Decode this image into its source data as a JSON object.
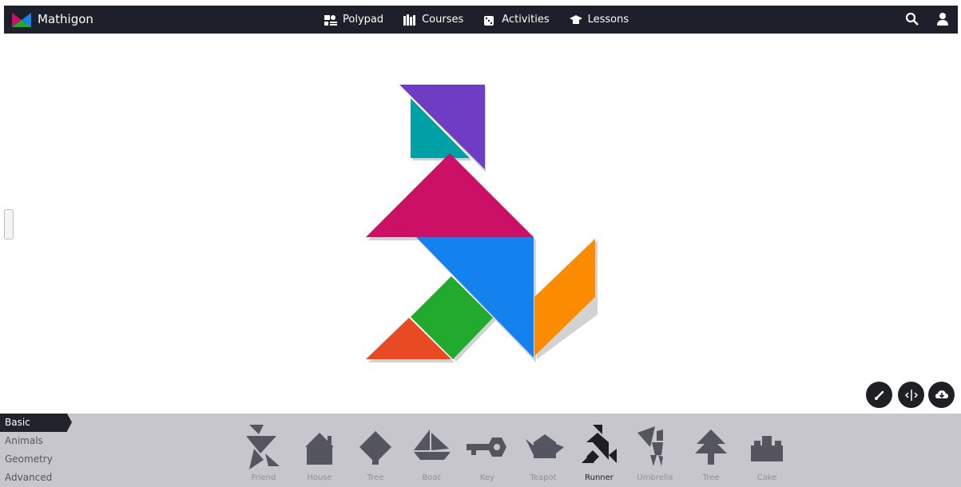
{
  "brand": {
    "name": "Mathigon"
  },
  "nav": [
    {
      "label": "Polypad",
      "icon": "polypad-icon"
    },
    {
      "label": "Courses",
      "icon": "courses-icon"
    },
    {
      "label": "Activities",
      "icon": "activities-icon"
    },
    {
      "label": "Lessons",
      "icon": "lessons-icon"
    }
  ],
  "top_right": [
    "search-icon",
    "user-icon"
  ],
  "tools": [
    "brush-icon",
    "mirror-icon",
    "cloud-download-icon"
  ],
  "categories": [
    {
      "label": "Basic",
      "active": true
    },
    {
      "label": "Animals",
      "active": false
    },
    {
      "label": "Geometry",
      "active": false
    },
    {
      "label": "Advanced",
      "active": false
    }
  ],
  "shapes": [
    {
      "label": "Friend",
      "active": false
    },
    {
      "label": "House",
      "active": false
    },
    {
      "label": "Tree",
      "active": false
    },
    {
      "label": "Boat",
      "active": false
    },
    {
      "label": "Key",
      "active": false
    },
    {
      "label": "Teapot",
      "active": false
    },
    {
      "label": "Runner",
      "active": true
    },
    {
      "label": "Umbrella",
      "active": false
    },
    {
      "label": "Tree",
      "active": false
    },
    {
      "label": "Cake",
      "active": false
    }
  ],
  "colors": {
    "topbar": "#1d1f2a",
    "purple": "#6e3dc4",
    "teal": "#00a0a6",
    "magenta": "#cc1066",
    "blue": "#1482ee",
    "orange": "#fb8c00",
    "green": "#21aa2d",
    "red": "#e84a23"
  }
}
